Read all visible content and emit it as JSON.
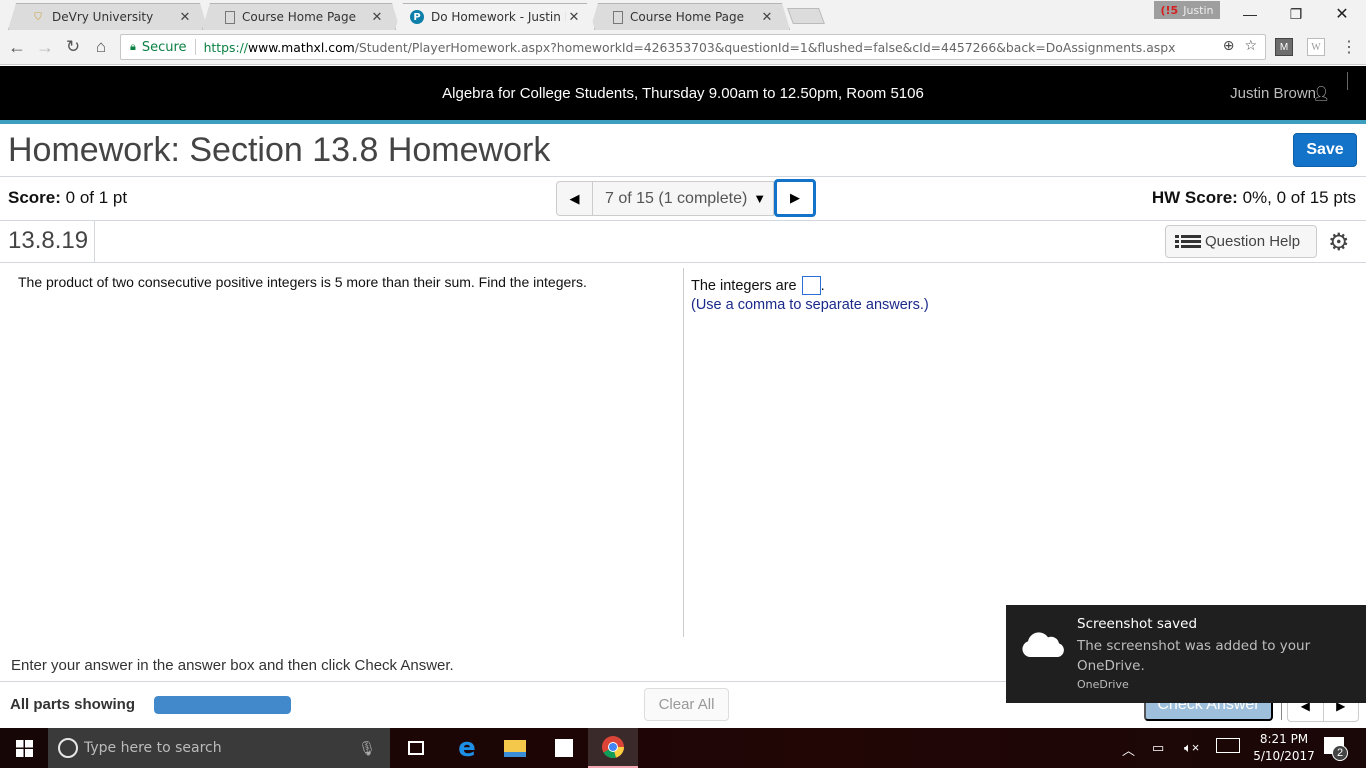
{
  "browser": {
    "tabs": [
      {
        "title": "DeVry University",
        "icon": "devry-shield-icon",
        "active": false
      },
      {
        "title": "Course Home Page",
        "icon": "page-icon",
        "active": false
      },
      {
        "title": "Do Homework - Justin Br",
        "icon": "pearson-p-icon",
        "active": true
      },
      {
        "title": "Course Home Page",
        "icon": "page-icon",
        "active": false
      }
    ],
    "close_glyph": "✕",
    "profile": {
      "name": "Justin",
      "badge": "(!5"
    },
    "window_controls": {
      "minimize": "—",
      "restore": "❐",
      "close": "✕"
    },
    "address": {
      "secure_label": "Secure",
      "scheme": "https://",
      "host": "www.mathxl.com",
      "path": "/Student/PlayerHomework.aspx?homeworkId=426353703&questionId=1&flushed=false&cId=4457266&back=DoAssignments.aspx"
    },
    "extensions": [
      "M",
      "W"
    ]
  },
  "course": {
    "title": "Algebra for College Students, Thursday 9.00am to 12.50pm, Room 5106",
    "user": "Justin Brown"
  },
  "homework": {
    "title": "Homework: Section 13.8 Homework",
    "save_label": "Save",
    "score_label": "Score:",
    "score_value": "0 of 1 pt",
    "question_selector": "7 of 15 (1 complete)",
    "hw_score_label": "HW Score:",
    "hw_score_value": "0%, 0 of 15 pts",
    "question_id": "13.8.19",
    "question_help_label": "Question Help"
  },
  "question": {
    "problem": "The product of two consecutive positive integers is 5 more than their sum. Find the integers.",
    "answer_prefix": "The integers are",
    "answer_suffix": ".",
    "answer_value": "",
    "hint": "(Use a comma to separate answers.)"
  },
  "footer": {
    "instruction": "Enter your answer in the answer box and then click Check Answer.",
    "parts_label": "All parts showing",
    "parts_progress": 1.0,
    "clear_all_label": "Clear All",
    "check_answer_label": "Check Answer"
  },
  "toast": {
    "title": "Screenshot saved",
    "body": "The screenshot was added to your OneDrive.",
    "source": "OneDrive"
  },
  "taskbar": {
    "search_placeholder": "Type here to search",
    "pinned": [
      "task-view",
      "edge",
      "file-explorer",
      "store",
      "chrome"
    ],
    "time": "8:21 PM",
    "date": "5/10/2017",
    "notifications": "2"
  },
  "colors": {
    "accent_blue": "#1273c8",
    "header_stripe": "#3d9ebf",
    "progress_fill": "#4289cb",
    "hint_text": "#1a2a8a"
  }
}
